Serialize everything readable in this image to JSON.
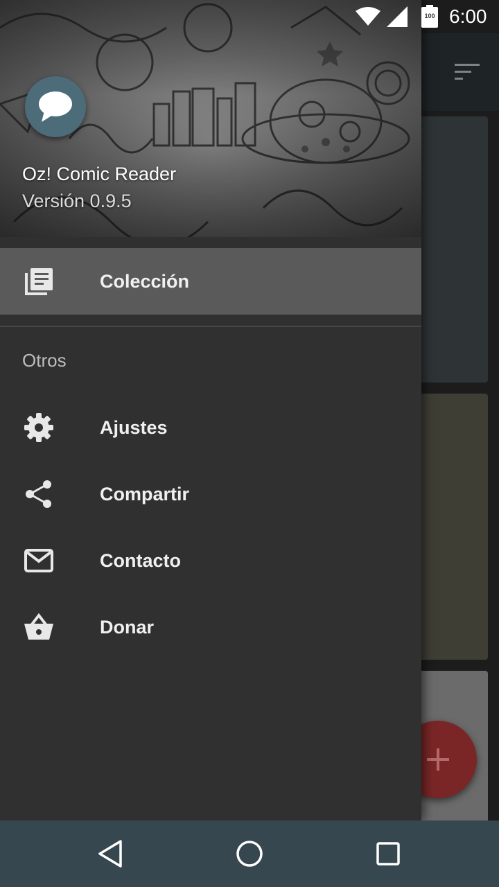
{
  "status_bar": {
    "time": "6:00",
    "battery_level": "100",
    "icons": [
      "wifi-icon",
      "cell-signal-icon",
      "battery-icon"
    ]
  },
  "drawer": {
    "header": {
      "app_name": "Oz! Comic Reader",
      "version": "Versión 0.9.5",
      "avatar_icon": "chat-bubble-icon"
    },
    "primary_items": [
      {
        "label": "Colección",
        "icon": "library-icon",
        "selected": true
      }
    ],
    "section_title": "Otros",
    "other_items": [
      {
        "label": "Ajustes",
        "icon": "gear-icon"
      },
      {
        "label": "Compartir",
        "icon": "share-icon"
      },
      {
        "label": "Contacto",
        "icon": "mail-icon"
      },
      {
        "label": "Donar",
        "icon": "basket-icon"
      }
    ]
  },
  "background_app": {
    "toolbar_icon": "sort-icon",
    "fab_icon": "plus-icon"
  },
  "system_nav": {
    "buttons": [
      "back-icon",
      "home-icon",
      "recents-icon"
    ]
  },
  "colors": {
    "drawer_bg": "#303030",
    "selected_item_bg": "#5a5a5a",
    "avatar_bg": "#4c6c79",
    "nav_bar_bg": "#37474f",
    "fab_bg": "#7a2626"
  }
}
